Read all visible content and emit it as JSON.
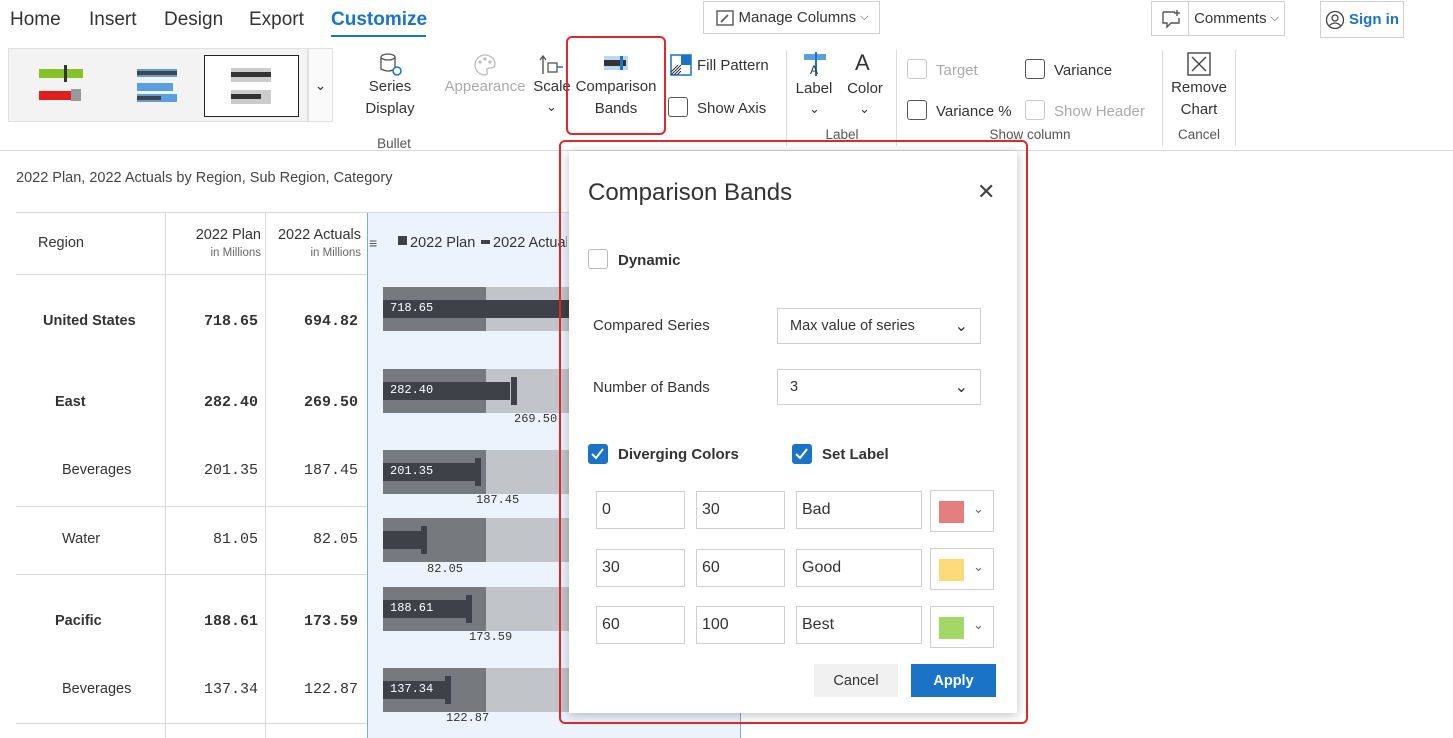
{
  "tabs": [
    {
      "label": "Home"
    },
    {
      "label": "Insert"
    },
    {
      "label": "Design"
    },
    {
      "label": "Export"
    },
    {
      "label": "Customize"
    }
  ],
  "top_buttons": {
    "manage_columns": "Manage Columns",
    "comments": "Comments",
    "sign_in": "Sign in"
  },
  "ribbon": {
    "series_display": "Series Display",
    "appearance": "Appearance",
    "scale": "Scale",
    "comparison_bands": "Comparison Bands",
    "fill_pattern": "Fill Pattern",
    "show_axis": "Show Axis",
    "label": "Label",
    "color": "Color",
    "target": "Target",
    "variance": "Variance",
    "variance_pct": "Variance %",
    "show_header": "Show Header",
    "remove_chart": "Remove Chart",
    "groups": {
      "bullet": "Bullet",
      "label": "Label",
      "show_column": "Show column",
      "cancel": "Cancel"
    }
  },
  "report": {
    "subtitle": "2022 Plan, 2022 Actuals by Region, Sub Region, Category",
    "headers": {
      "region": "Region",
      "plan": "2022 Plan",
      "plan_unit": "in Millions",
      "actuals": "2022 Actuals",
      "actuals_unit": "in Millions",
      "legend_plan": "2022 Plan",
      "legend_actuals": "2022 Actuals"
    },
    "rows": [
      {
        "name": "United States",
        "plan": "718.65",
        "actual": "694.82",
        "bold": true,
        "indent": 0,
        "plan_label": "718.65",
        "actual_label": ""
      },
      {
        "name": "East",
        "plan": "282.40",
        "actual": "269.50",
        "bold": true,
        "indent": 1,
        "plan_label": "282.40",
        "actual_label": "269.50"
      },
      {
        "name": "Beverages",
        "plan": "201.35",
        "actual": "187.45",
        "bold": false,
        "indent": 2,
        "plan_label": "201.35",
        "actual_label": "187.45"
      },
      {
        "name": "Water",
        "plan": "81.05",
        "actual": "82.05",
        "bold": false,
        "indent": 2,
        "plan_label": "",
        "actual_label": "82.05"
      },
      {
        "name": "Pacific",
        "plan": "188.61",
        "actual": "173.59",
        "bold": true,
        "indent": 1,
        "plan_label": "188.61",
        "actual_label": "173.59"
      },
      {
        "name": "Beverages",
        "plan": "137.34",
        "actual": "122.87",
        "bold": false,
        "indent": 2,
        "plan_label": "137.34",
        "actual_label": "122.87"
      }
    ]
  },
  "dialog": {
    "title": "Comparison Bands",
    "dynamic": "Dynamic",
    "compared_series_label": "Compared Series",
    "compared_series_value": "Max value of series",
    "number_of_bands_label": "Number of Bands",
    "number_of_bands_value": "3",
    "diverging_colors": "Diverging Colors",
    "set_label": "Set Label",
    "bands": [
      {
        "from": "0",
        "to": "30",
        "label": "Bad",
        "color": "#e57f7f"
      },
      {
        "from": "30",
        "to": "60",
        "label": "Good",
        "color": "#ffd97a"
      },
      {
        "from": "60",
        "to": "100",
        "label": "Best",
        "color": "#a3d867"
      }
    ],
    "cancel": "Cancel",
    "apply": "Apply"
  },
  "colors": {
    "accent": "#1a73c6",
    "highlight": "#e0282e",
    "plan_bar": "#3e4147",
    "band_dark": "#76797e",
    "band_light": "#c1c4c8"
  }
}
